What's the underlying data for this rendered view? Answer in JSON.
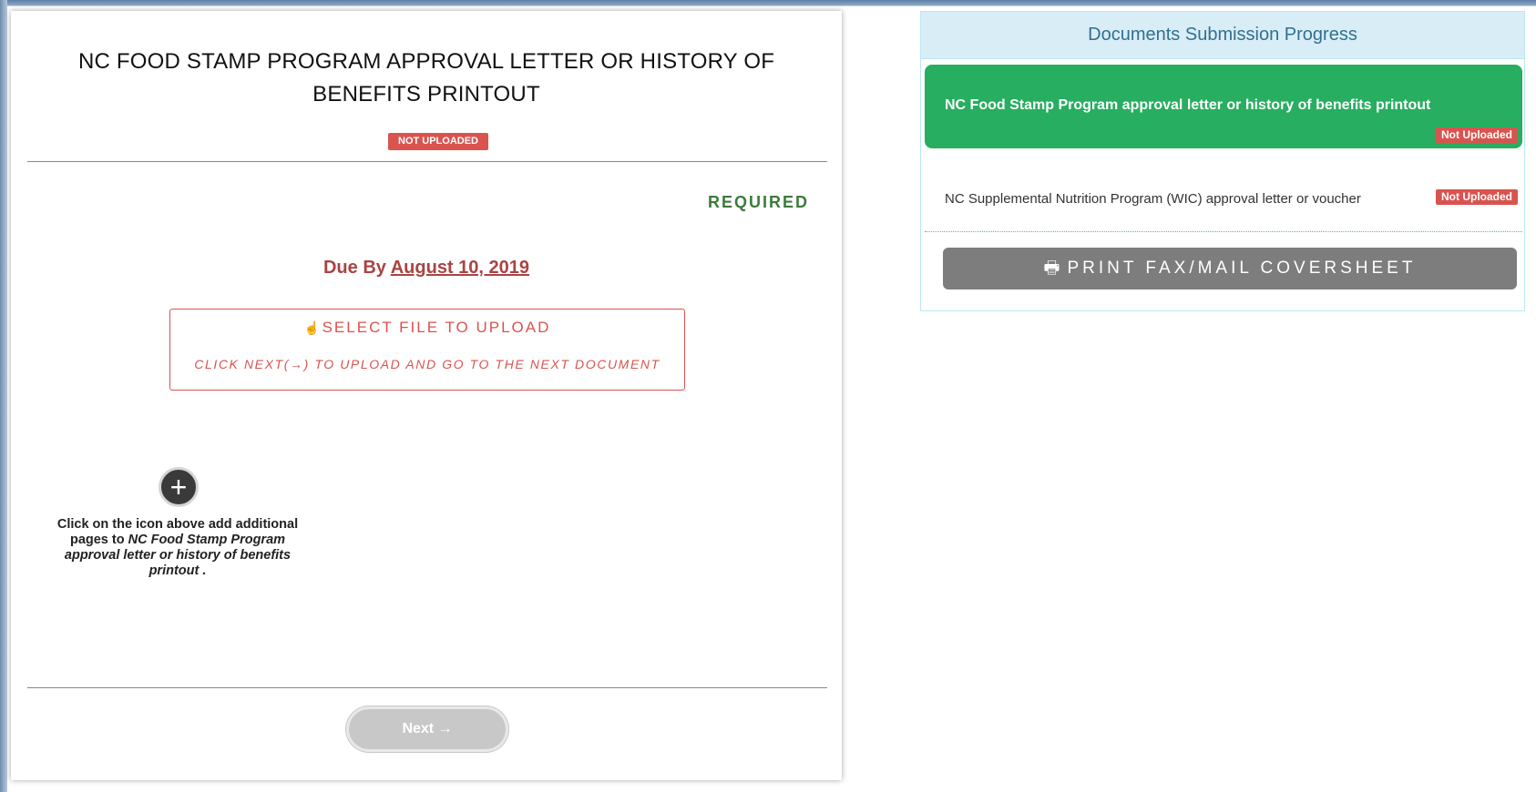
{
  "document": {
    "title": "NC FOOD STAMP PROGRAM APPROVAL LETTER OR HISTORY OF BENEFITS PRINTOUT",
    "status_badge": "NOT UPLOADED",
    "required_label": "REQUIRED",
    "due_prefix": "Due By",
    "due_date": "August 10, 2019",
    "upload": {
      "icon": "hand-pointer-icon",
      "select_label": "SELECT FILE TO UPLOAD",
      "hint": "CLICK NEXT(→) TO UPLOAD AND GO TO THE NEXT DOCUMENT"
    },
    "add_pages": {
      "icon": "plus-icon",
      "caption_prefix": "Click on the icon above add additional pages to",
      "caption_doc": "NC Food Stamp Program approval letter or history of benefits printout",
      "caption_suffix": "."
    },
    "next_button": "Next →"
  },
  "progress": {
    "header": "Documents Submission Progress",
    "items": [
      {
        "label": "NC Food Stamp Program approval letter or history of benefits printout",
        "badge": "Not Uploaded",
        "active": true
      },
      {
        "label": "NC Supplemental Nutrition Program (WIC) approval letter or voucher",
        "badge": "Not Uploaded",
        "active": false
      }
    ],
    "print_button": "PRINT FAX/MAIL COVERSHEET",
    "print_icon": "printer-icon"
  },
  "colors": {
    "accent_green": "#27ae60",
    "required_green": "#3c7a3c",
    "danger_red": "#d9534f",
    "due_red": "#a94442",
    "panel_header_bg": "#d9edf7",
    "panel_header_text": "#31708f"
  }
}
